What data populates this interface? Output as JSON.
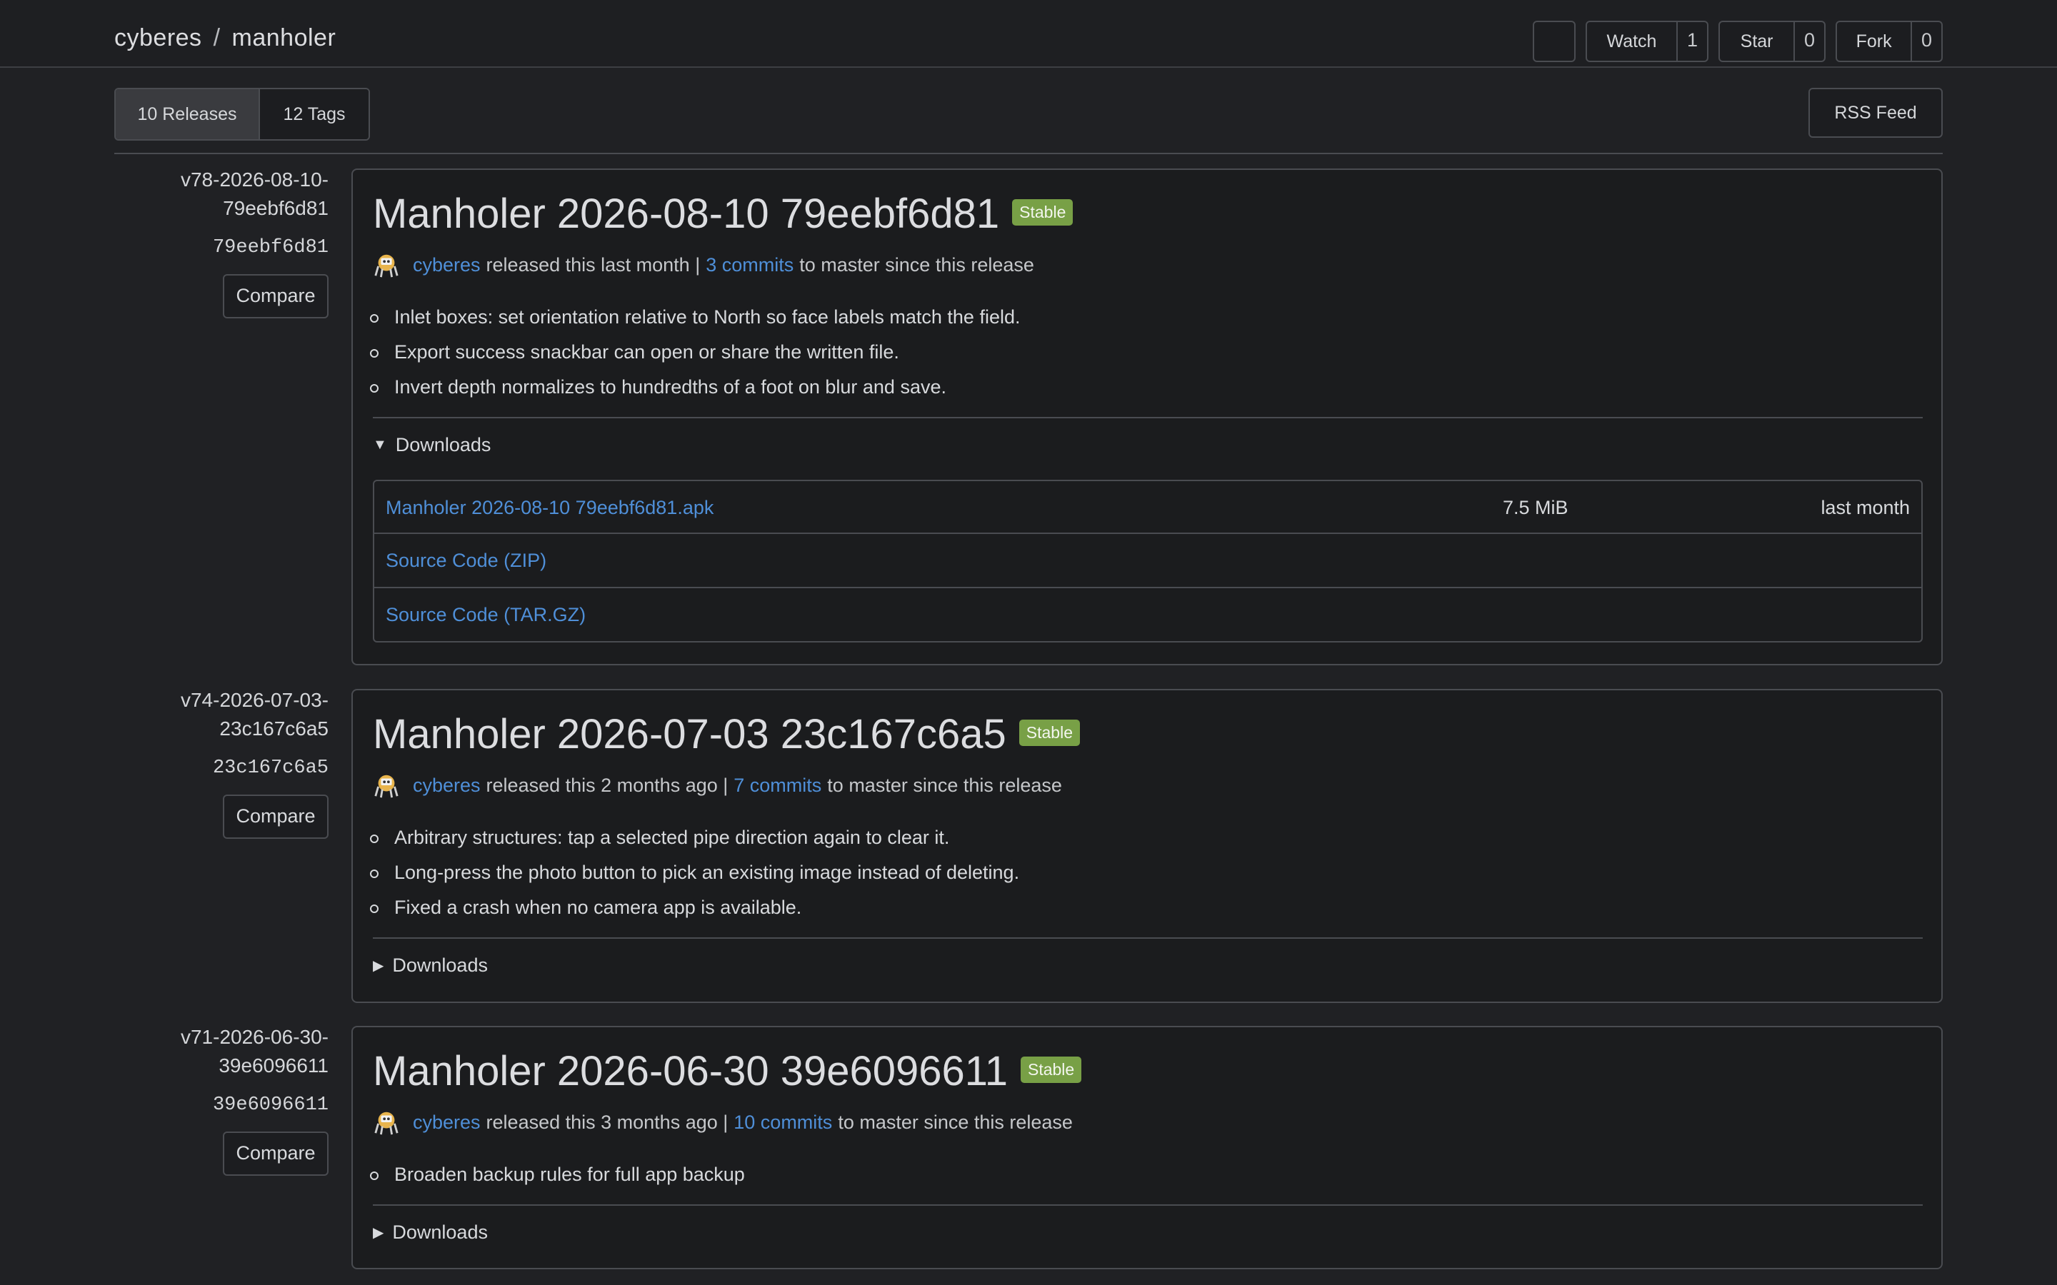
{
  "repo": {
    "owner": "cyberes",
    "separator": "/",
    "name": "manholer"
  },
  "actions": {
    "watch": {
      "label": "Watch",
      "count": "1"
    },
    "star": {
      "label": "Star",
      "count": "0"
    },
    "fork": {
      "label": "Fork",
      "count": "0"
    }
  },
  "tabs": {
    "releases": "10 Releases",
    "tags": "12 Tags"
  },
  "rss_label": "RSS Feed",
  "releases": [
    {
      "tag_line1": "v78-2026-08-10-",
      "tag_line2": "79eebf6d81",
      "sha": "79eebf6d81",
      "compare": "Compare",
      "title": "Manholer 2026-08-10 79eebf6d81",
      "badge": "Stable",
      "author": "cyberes",
      "released": "released this last month |",
      "commits": "3 commits",
      "since": "to master since this release",
      "notes": [
        "Inlet boxes: set orientation relative to North so face labels match the field.",
        "Export success snackbar can open or share the written file.",
        "Invert depth normalizes to hundredths of a foot on blur and save."
      ],
      "downloads_label": "Downloads",
      "downloads_open": true,
      "assets": [
        {
          "name": "Manholer 2026-08-10 79eebf6d81.apk",
          "size": "7.5 MiB",
          "date": "last month"
        },
        {
          "name": "Source Code (ZIP)",
          "size": "",
          "date": ""
        },
        {
          "name": "Source Code (TAR.GZ)",
          "size": "",
          "date": ""
        }
      ]
    },
    {
      "tag_line1": "v74-2026-07-03-",
      "tag_line2": "23c167c6a5",
      "sha": "23c167c6a5",
      "compare": "Compare",
      "title": "Manholer 2026-07-03 23c167c6a5",
      "badge": "Stable",
      "author": "cyberes",
      "released": "released this 2 months ago |",
      "commits": "7 commits",
      "since": "to master since this release",
      "notes": [
        "Arbitrary structures: tap a selected pipe direction again to clear it.",
        "Long-press the photo button to pick an existing image instead of deleting.",
        "Fixed a crash when no camera app is available."
      ],
      "downloads_label": "Downloads",
      "downloads_open": false
    },
    {
      "tag_line1": "v71-2026-06-30-",
      "tag_line2": "39e6096611",
      "sha": "39e6096611",
      "compare": "Compare",
      "title": "Manholer 2026-06-30 39e6096611",
      "badge": "Stable",
      "author": "cyberes",
      "released": "released this 3 months ago |",
      "commits": "10 commits",
      "since": "to master since this release",
      "notes": [
        "Broaden backup rules for full app backup"
      ],
      "downloads_label": "Downloads",
      "downloads_open": false
    }
  ],
  "colors": {
    "link": "#4f8fd8",
    "badge": "#78a046",
    "background": "#202124"
  }
}
